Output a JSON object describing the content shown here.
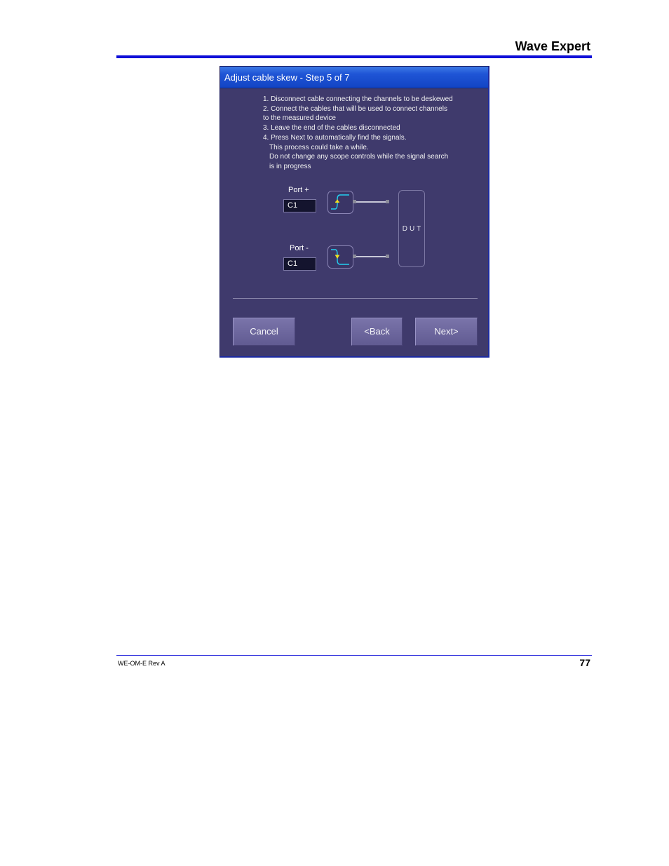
{
  "header": {
    "title": "Wave Expert"
  },
  "dialog": {
    "title": "Adjust cable skew - Step 5 of 7",
    "instructions": [
      "1. Disconnect cable connecting the channels to be deskewed",
      "2. Connect the cables that will be used to connect channels",
      "to the measured device",
      "3. Leave the end of the cables disconnected",
      "4. Press Next to automatically find the signals.",
      "This process could take a while.",
      "Do not change any scope controls while the signal search",
      "is in progress"
    ],
    "port_plus": {
      "label": "Port +",
      "value": "C1"
    },
    "port_minus": {
      "label": "Port -",
      "value": "C1"
    },
    "dut_label": "DUT",
    "buttons": {
      "cancel": "Cancel",
      "back": "<Back",
      "next": "Next>"
    }
  },
  "footer": {
    "doc_id": "WE-OM-E Rev A",
    "page_number": "77"
  },
  "colors": {
    "accent_rule": "#1010d8",
    "dialog_bg": "#3f3a6c",
    "titlebar": "#1f55d6",
    "signal_trace": "#22d0f0",
    "signal_arrow": "#f0e020"
  }
}
